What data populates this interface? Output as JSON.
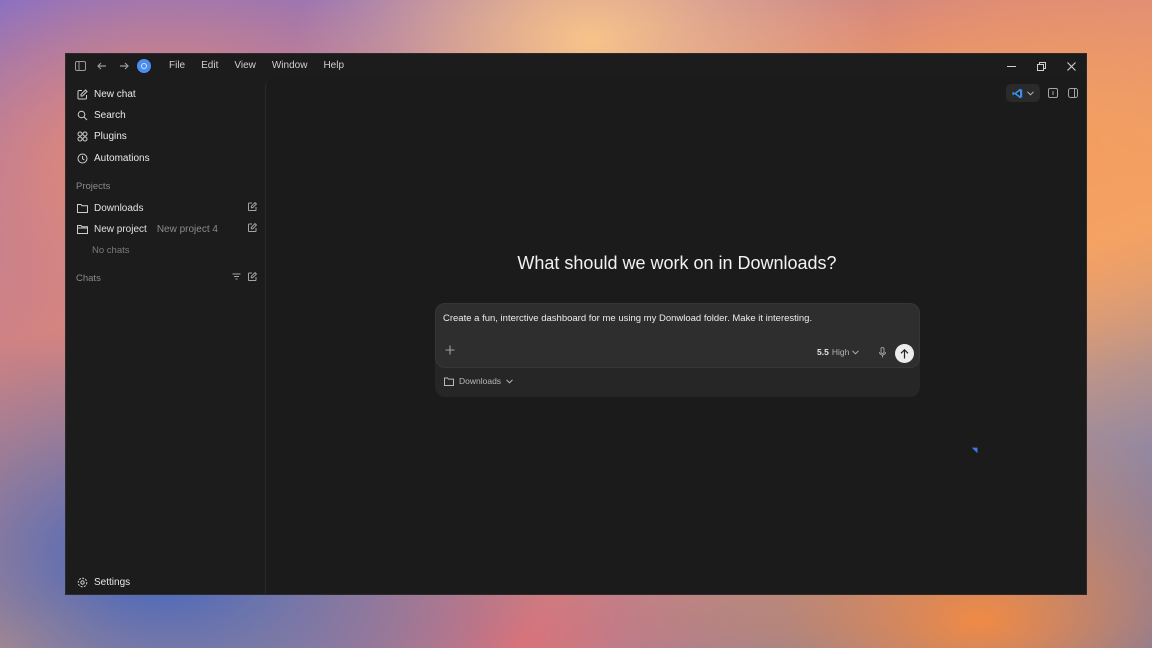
{
  "titlebar": {
    "menu": [
      "File",
      "Edit",
      "View",
      "Window",
      "Help"
    ]
  },
  "sidebar": {
    "nav": [
      {
        "label": "New chat",
        "icon": "compose-icon"
      },
      {
        "label": "Search",
        "icon": "search-icon"
      },
      {
        "label": "Plugins",
        "icon": "plugins-icon"
      },
      {
        "label": "Automations",
        "icon": "clock-icon"
      }
    ],
    "projects_label": "Projects",
    "projects": [
      {
        "name": "Downloads",
        "sub": ""
      },
      {
        "name": "New project",
        "sub": "New project 4"
      }
    ],
    "no_chats": "No chats",
    "chats_label": "Chats",
    "settings_label": "Settings"
  },
  "main": {
    "headline": "What should we work on in Downloads?",
    "composer": {
      "prompt": "Create a fun, interctive dashboard for me using my Donwload folder. Make it interesting.",
      "model_version": "5.5",
      "model_effort": "High",
      "folder": "Downloads"
    }
  },
  "colors": {
    "accent": "#4a8df0",
    "window_bg": "#1a1a1a",
    "composer_bg": "#2e2e2e"
  }
}
